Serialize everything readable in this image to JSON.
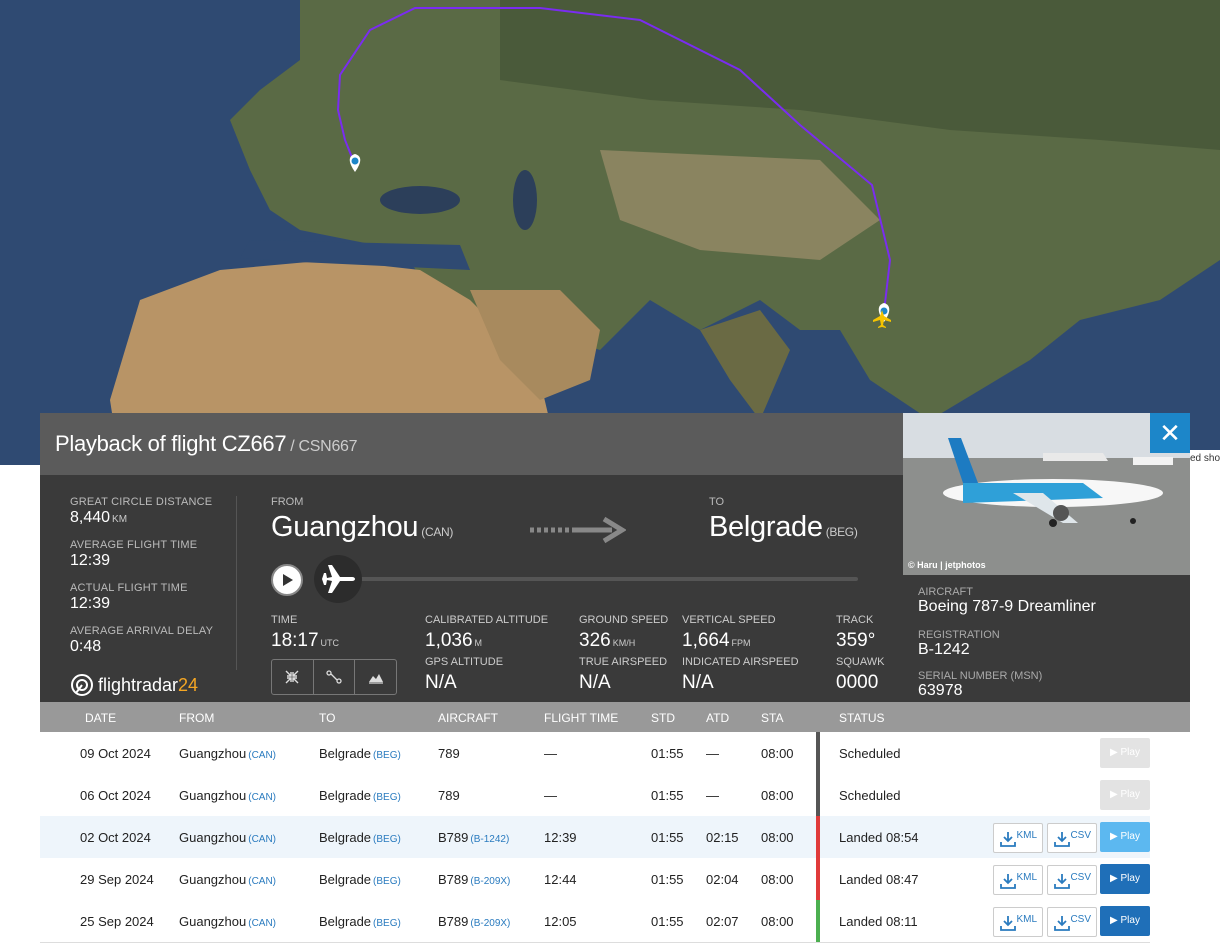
{
  "map": {
    "edge_text": "ed shor"
  },
  "panel": {
    "title": "Playback of flight CZ667",
    "subtitle": "/ CSN667",
    "close_glyph": "✕",
    "stats": {
      "gcd_label": "GREAT CIRCLE DISTANCE",
      "gcd_value": "8,440",
      "gcd_unit": "KM",
      "avg_time_label": "AVERAGE FLIGHT TIME",
      "avg_time_value": "12:39",
      "act_time_label": "ACTUAL FLIGHT TIME",
      "act_time_value": "12:39",
      "delay_label": "AVERAGE ARRIVAL DELAY",
      "delay_value": "0:48"
    },
    "route": {
      "from_label": "FROM",
      "from_city": "Guangzhou",
      "from_code": "(CAN)",
      "to_label": "TO",
      "to_city": "Belgrade",
      "to_code": "(BEG)"
    },
    "playback_progress": 0,
    "metrics": {
      "time_label": "TIME",
      "time_value": "18:17",
      "time_unit": "UTC",
      "cal_alt_label": "CALIBRATED ALTITUDE",
      "cal_alt_value": "1,036",
      "cal_alt_unit": "M",
      "gps_alt_label": "GPS ALTITUDE",
      "gps_alt_value": "N/A",
      "gs_label": "GROUND SPEED",
      "gs_value": "326",
      "gs_unit": "KM/H",
      "tas_label": "TRUE AIRSPEED",
      "tas_value": "N/A",
      "vs_label": "VERTICAL SPEED",
      "vs_value": "1,664",
      "vs_unit": "FPM",
      "ias_label": "INDICATED AIRSPEED",
      "ias_value": "N/A",
      "track_label": "TRACK",
      "track_value": "359°",
      "squawk_label": "SQUAWK",
      "squawk_value": "0000"
    },
    "logo": {
      "text": "flightradar",
      "num": "24"
    },
    "photo_credit": "© Haru | jetphotos",
    "aircraft": {
      "aircraft_label": "AIRCRAFT",
      "aircraft_value": "Boeing 787-9 Dreamliner",
      "reg_label": "REGISTRATION",
      "reg_value": "B-1242",
      "msn_label": "SERIAL NUMBER (MSN)",
      "msn_value": "63978"
    }
  },
  "table": {
    "headers": [
      "DATE",
      "FROM",
      "TO",
      "AIRCRAFT",
      "FLIGHT TIME",
      "STD",
      "ATD",
      "STA",
      "STATUS"
    ],
    "kml_label": "KML",
    "csv_label": "CSV",
    "play_label": "▶ Play",
    "rows": [
      {
        "date": "09 Oct 2024",
        "from": "Guangzhou",
        "from_code": "(CAN)",
        "to": "Belgrade",
        "to_code": "(BEG)",
        "aircraft": "789",
        "aircraft_reg": "",
        "flight_time": "—",
        "std": "01:55",
        "atd": "—",
        "sta": "08:00",
        "status": "Scheduled",
        "status_color": "#555555"
      },
      {
        "date": "06 Oct 2024",
        "from": "Guangzhou",
        "from_code": "(CAN)",
        "to": "Belgrade",
        "to_code": "(BEG)",
        "aircraft": "789",
        "aircraft_reg": "",
        "flight_time": "—",
        "std": "01:55",
        "atd": "—",
        "sta": "08:00",
        "status": "Scheduled",
        "status_color": "#555555"
      },
      {
        "date": "02 Oct 2024",
        "from": "Guangzhou",
        "from_code": "(CAN)",
        "to": "Belgrade",
        "to_code": "(BEG)",
        "aircraft": "B789",
        "aircraft_reg": "(B-1242)",
        "flight_time": "12:39",
        "std": "01:55",
        "atd": "02:15",
        "sta": "08:00",
        "status": "Landed 08:54",
        "status_color": "#e03a3a"
      },
      {
        "date": "29 Sep 2024",
        "from": "Guangzhou",
        "from_code": "(CAN)",
        "to": "Belgrade",
        "to_code": "(BEG)",
        "aircraft": "B789",
        "aircraft_reg": "(B-209X)",
        "flight_time": "12:44",
        "std": "01:55",
        "atd": "02:04",
        "sta": "08:00",
        "status": "Landed 08:47",
        "status_color": "#e03a3a"
      },
      {
        "date": "25 Sep 2024",
        "from": "Guangzhou",
        "from_code": "(CAN)",
        "to": "Belgrade",
        "to_code": "(BEG)",
        "aircraft": "B789",
        "aircraft_reg": "(B-209X)",
        "flight_time": "12:05",
        "std": "01:55",
        "atd": "02:07",
        "sta": "08:00",
        "status": "Landed 08:11",
        "status_color": "#4caf50"
      }
    ]
  }
}
